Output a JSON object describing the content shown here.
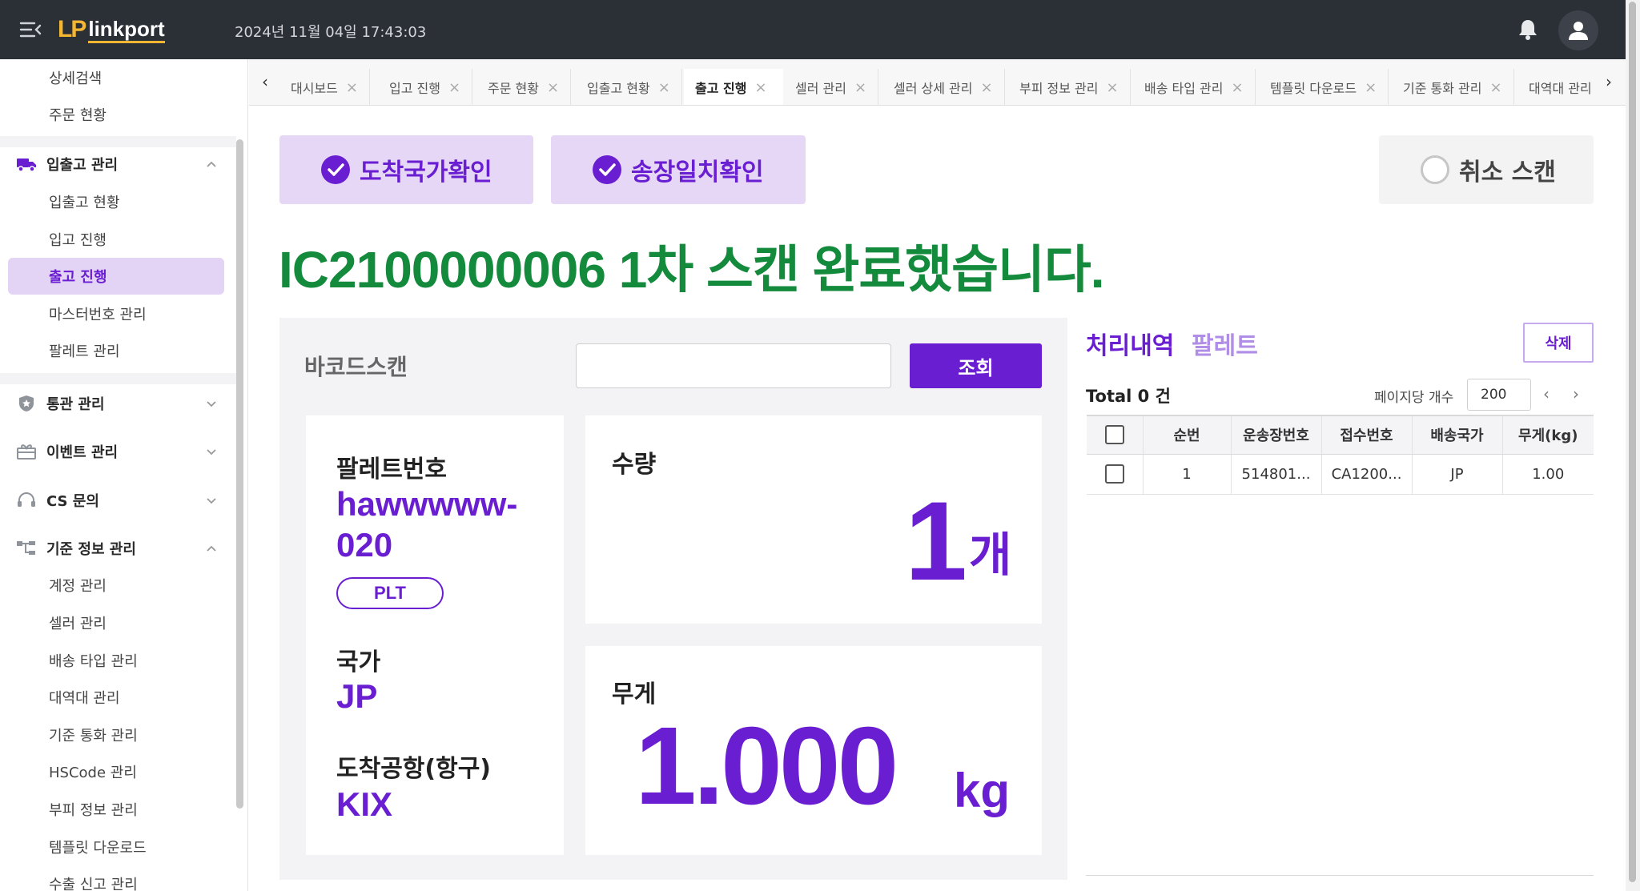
{
  "header": {
    "logo_mark": "LP",
    "logo_text": "linkport",
    "datetime": "2024년 11월 04일 17:43:03"
  },
  "sidebar": {
    "top_items": [
      "상세검색",
      "주문 현황"
    ],
    "groups": [
      {
        "label": "입출고 관리",
        "icon": "truck-icon",
        "expanded": true,
        "items": [
          "입출고 현황",
          "입고 진행",
          "출고 진행",
          "마스터번호 관리",
          "팔레트 관리"
        ],
        "active": "출고 진행"
      },
      {
        "label": "통관 관리",
        "icon": "shield-star-icon",
        "expanded": false
      },
      {
        "label": "이벤트 관리",
        "icon": "gift-icon",
        "expanded": false
      },
      {
        "label": "CS 문의",
        "icon": "headset-icon",
        "expanded": false
      },
      {
        "label": "기준 정보 관리",
        "icon": "tree-structure-icon",
        "expanded": true,
        "items": [
          "계정 관리",
          "셀러 관리",
          "배송 타입 관리",
          "대역대 관리",
          "기준 통화 관리",
          "HSCode 관리",
          "부피 정보 관리",
          "템플릿 다운로드",
          "수출 신고 관리"
        ]
      }
    ]
  },
  "tabs": [
    {
      "label": "대시보드"
    },
    {
      "label": "입고 진행"
    },
    {
      "label": "주문 현황"
    },
    {
      "label": "입출고 현황"
    },
    {
      "label": "출고 진행",
      "active": true
    },
    {
      "label": "셀러 관리"
    },
    {
      "label": "셀러 상세 관리"
    },
    {
      "label": "부피 정보 관리"
    },
    {
      "label": "배송 타입 관리"
    },
    {
      "label": "템플릿 다운로드"
    },
    {
      "label": "기준 통화 관리"
    },
    {
      "label": "대역대 관리"
    }
  ],
  "checks": {
    "arrival_country": "도착국가확인",
    "invoice_match": "송장일치확인",
    "cancel_scan": "취소 스캔"
  },
  "scan_message": "IC2100000006 1차 스캔 완료했습니다.",
  "barcode": {
    "label": "바코드스캔",
    "value": "",
    "lookup_label": "조회"
  },
  "pallet": {
    "number_label": "팔레트번호",
    "number_line1": "hawwwww-",
    "number_line2": "020",
    "badge": "PLT",
    "country_label": "국가",
    "country": "JP",
    "airport_label": "도착공항(항구)",
    "airport": "KIX"
  },
  "quantity": {
    "label": "수량",
    "value": "1",
    "unit": "개"
  },
  "weight": {
    "label": "무게",
    "value": "1.000",
    "unit": "kg"
  },
  "right_panel": {
    "tab_history": "처리내역",
    "tab_pallet": "팔레트",
    "delete_label": "삭제",
    "total": "Total 0 건",
    "per_page_label": "페이지당 개수",
    "per_page": "200",
    "columns": [
      "순번",
      "운송장번호",
      "접수번호",
      "배송국가",
      "무게(kg)"
    ],
    "rows": [
      {
        "seq": "1",
        "waybill": "514801...",
        "receipt": "CA1200...",
        "country": "JP",
        "weight": "1.00"
      }
    ]
  },
  "colors": {
    "brand": "#6a1ed1",
    "success": "#148a3c",
    "header_bg": "#2b2f36",
    "logo_accent": "#f5b731"
  }
}
